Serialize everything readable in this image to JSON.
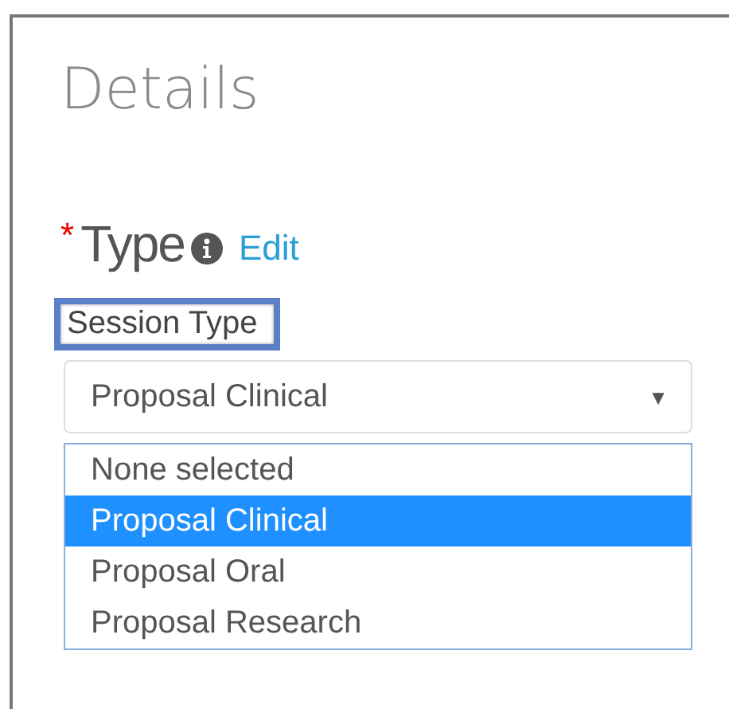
{
  "heading": "Details",
  "field": {
    "required_mark": "*",
    "label": "Type",
    "edit_link": "Edit"
  },
  "session_type": {
    "label": "Session Type",
    "highlighted": true,
    "value": "Proposal Clinical",
    "arrow": "▼",
    "options": [
      {
        "label": "None selected",
        "selected": false
      },
      {
        "label": "Proposal Clinical",
        "selected": true
      },
      {
        "label": "Proposal Oral",
        "selected": false
      },
      {
        "label": "Proposal Research",
        "selected": false
      }
    ]
  }
}
